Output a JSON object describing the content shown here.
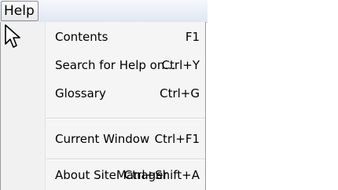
{
  "menubar": {
    "title": "Help"
  },
  "menu": {
    "items": [
      {
        "label": "Contents",
        "shortcut": "F1"
      },
      {
        "label": "Search for Help on...",
        "shortcut": "Ctrl+Y"
      },
      {
        "label": "Glossary",
        "shortcut": "Ctrl+G"
      },
      {
        "label": "Current Window",
        "shortcut": "Ctrl+F1"
      },
      {
        "label": "About SiteManager",
        "shortcut": "Ctrl+Shift+A"
      }
    ]
  },
  "icons": {
    "cursor": "mouse-pointer-icon"
  }
}
